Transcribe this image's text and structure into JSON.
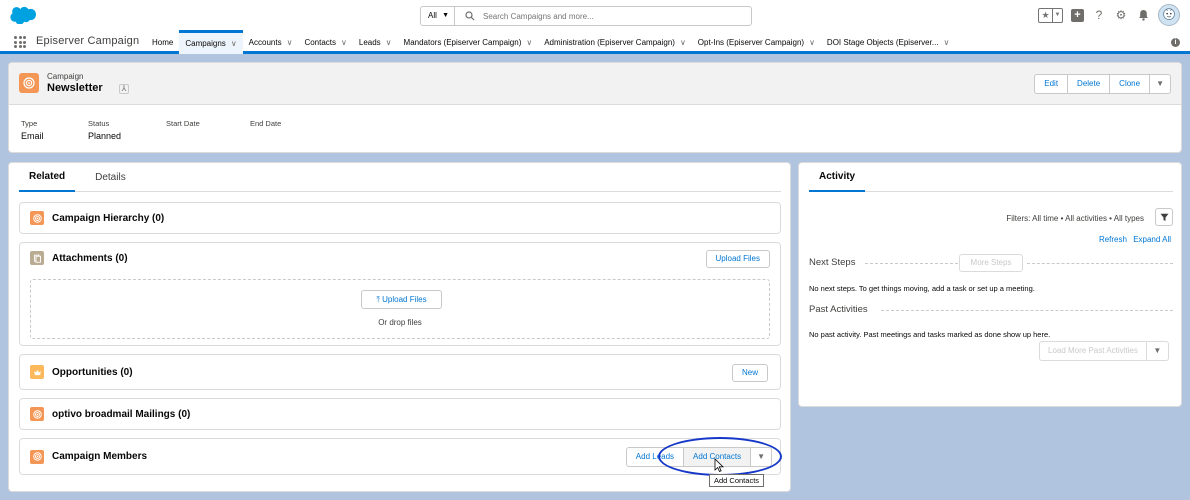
{
  "header": {
    "search_scope": "All",
    "search_placeholder": "Search Campaigns and more..."
  },
  "nav": {
    "app_name": "Episerver Campaign",
    "items": [
      {
        "label": "Home",
        "has_menu": false
      },
      {
        "label": "Campaigns",
        "has_menu": true,
        "active": true
      },
      {
        "label": "Accounts",
        "has_menu": true
      },
      {
        "label": "Contacts",
        "has_menu": true
      },
      {
        "label": "Leads",
        "has_menu": true
      },
      {
        "label": "Mandators (Episerver Campaign)",
        "has_menu": true
      },
      {
        "label": "Administration (Episerver Campaign)",
        "has_menu": true
      },
      {
        "label": "Opt-Ins (Episerver Campaign)",
        "has_menu": true
      },
      {
        "label": "DOI Stage Objects (Episerver...",
        "has_menu": true
      }
    ]
  },
  "record": {
    "object_type": "Campaign",
    "name": "Newsletter",
    "actions": {
      "edit": "Edit",
      "delete": "Delete",
      "clone": "Clone"
    },
    "fields": [
      {
        "label": "Type",
        "value": "Email"
      },
      {
        "label": "Status",
        "value": "Planned"
      },
      {
        "label": "Start Date",
        "value": ""
      },
      {
        "label": "End Date",
        "value": ""
      }
    ]
  },
  "related": {
    "tabs": {
      "related": "Related",
      "details": "Details"
    },
    "campaign_hierarchy": "Campaign Hierarchy (0)",
    "attachments": {
      "title": "Attachments (0)",
      "upload_button": "Upload Files",
      "drop_upload": "Upload Files",
      "drop_text": "Or drop files"
    },
    "opportunities": {
      "title": "Opportunities (0)",
      "new_button": "New"
    },
    "mailings": "optivo broadmail Mailings (0)",
    "members": {
      "title": "Campaign Members",
      "add_leads": "Add Leads",
      "add_contacts": "Add Contacts",
      "tooltip": "Add Contacts"
    }
  },
  "activity": {
    "tab": "Activity",
    "filters": "Filters: All time • All activities • All types",
    "refresh": "Refresh",
    "expand_all": "Expand All",
    "next_steps_title": "Next Steps",
    "more_steps": "More Steps",
    "next_steps_text": "No next steps. To get things moving, add a task or set up a meeting.",
    "past_title": "Past Activities",
    "past_text": "No past activity. Past meetings and tasks marked as done show up here.",
    "load_more": "Load More Past Activities"
  },
  "colors": {
    "brand": "#0176d3",
    "campaign_icon": "#f49756",
    "opportunity_icon": "#fcb95b",
    "attachment_icon": "#baac93",
    "highlight": "#1538c9"
  }
}
